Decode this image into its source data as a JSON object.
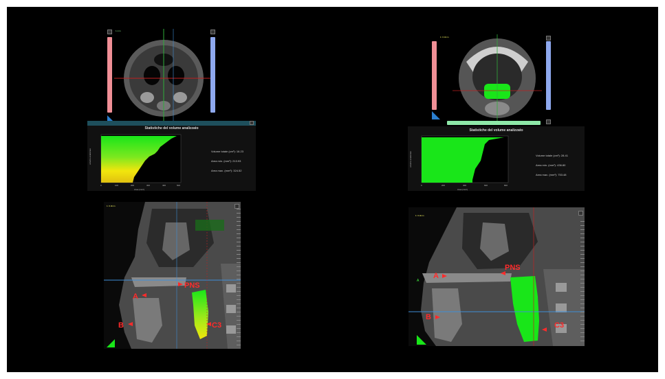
{
  "left_panel": {
    "axial": {
      "scale_label": "1 mm"
    },
    "stats": {
      "title": "Statistiche del volume analizzato",
      "volume_label": "Volume totale (cm³):",
      "volume_value": "16.23",
      "area_min_label": "Area min. (mm²):",
      "area_min_value": "213.93",
      "area_max_label": "Area max. (mm²):",
      "area_max_value": "324.52",
      "y_axis_label": "volume analizzato",
      "x_axis_label": "Area (mm²)",
      "x_ticks": [
        "0",
        "100",
        "200",
        "300",
        "400",
        "500"
      ]
    },
    "sagittal": {
      "scale_label": "1: 0.3mm",
      "labels": {
        "pns": "PNS",
        "a": "A",
        "b": "B",
        "c3": "C3"
      }
    }
  },
  "right_panel": {
    "axial": {
      "scale_label": "1: 0.3mm"
    },
    "stats": {
      "title": "Statistiche del volume analizzato",
      "volume_label": "Volume totale (cm³):",
      "volume_value": "28.41",
      "area_min_label": "Area min. (mm²):",
      "area_min_value": "436.80",
      "area_max_label": "Area max. (mm²):",
      "area_max_value": "753.48",
      "y_axis_label": "volume analizzato",
      "x_axis_label": "Area (mm²)",
      "x_ticks": [
        "0",
        "200",
        "400",
        "600",
        "800"
      ]
    },
    "sagittal": {
      "scale_label": "1: 0.3mm",
      "side_label": "A",
      "labels": {
        "pns": "PNS",
        "a": "A",
        "b": "B",
        "c3": "C3"
      }
    }
  },
  "colors": {
    "airway_green": "#19e619",
    "airway_yellow": "#f2e60d",
    "slider_red": "#f08f96",
    "slider_blue": "#8ea8ee",
    "slider_green": "#8ee8a8",
    "crosshair_red": "#c02020",
    "crosshair_blue": "#3f8fd8",
    "landmark_red": "#ff2b2b"
  }
}
